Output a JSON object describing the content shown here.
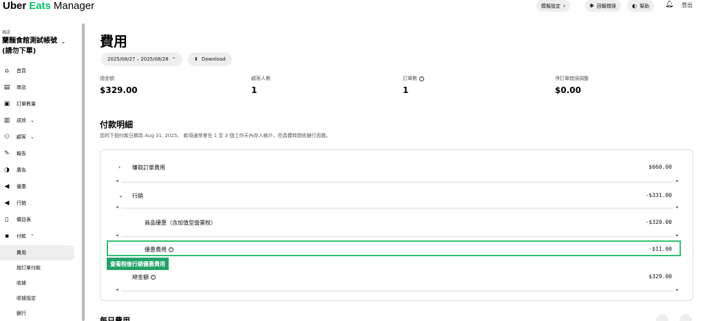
{
  "header": {
    "logo": {
      "uber": "Uber",
      "eats": "Eats",
      "manager": "Manager"
    },
    "buttons": [
      {
        "label": "模擬設定",
        "icon": "chevron-right-icon"
      },
      {
        "label": "回報錯誤",
        "icon": "bug-icon"
      },
      {
        "label": "幫助",
        "icon": "headset-icon"
      }
    ],
    "logout": "登出"
  },
  "sidebar": {
    "store_label": "商店",
    "store_name": "蘭麵食館測試帳號(請勿下單)",
    "items": [
      {
        "label": "首頁",
        "icon": "home-icon"
      },
      {
        "label": "商店",
        "icon": "store-icon"
      },
      {
        "label": "訂單數量",
        "icon": "receipt-icon"
      },
      {
        "label": "成效",
        "icon": "bar-chart-icon"
      },
      {
        "label": "顧客",
        "icon": "people-icon"
      },
      {
        "label": "報告",
        "icon": "report-icon"
      },
      {
        "label": "廣告",
        "icon": "ads-icon"
      },
      {
        "label": "優惠",
        "icon": "megaphone-icon"
      },
      {
        "label": "行銷",
        "icon": "megaphone-icon"
      },
      {
        "label": "價目表",
        "icon": "book-icon"
      },
      {
        "label": "付款",
        "icon": "wallet-icon"
      }
    ],
    "sub_items": [
      "費用",
      "按訂單付款",
      "收據",
      "收據設定",
      "銀行"
    ]
  },
  "main": {
    "title": "費用",
    "date_range": "2025/08/27 – 2025/08/28",
    "download_label": "Download",
    "stats": [
      {
        "label": "總金額",
        "value": "$329.00"
      },
      {
        "label": "顧客人數",
        "value": "1"
      },
      {
        "label": "訂單數",
        "value": "1"
      },
      {
        "label": "淨訂單錯誤調整",
        "value": "$0.00"
      }
    ],
    "payment_title": "付款明細",
    "payment_desc": "您的下個付款日期為 Aug 31, 2025。 款項通常會在 1 至 3 個工作天內存入帳戶，但具體時間依銀行而異。",
    "rows": [
      {
        "label": "賺取訂單費用",
        "amount": "$660.00"
      },
      {
        "label": "行銷",
        "amount": "-$331.00"
      },
      {
        "label": "商品優惠（含加值型營業稅）",
        "amount": "-$320.00"
      },
      {
        "label": "優惠費用",
        "amount": "-$11.00"
      },
      {
        "label": "總金額",
        "amount": "$329.00"
      }
    ],
    "highlight_tag": "查看稅後行銷優惠費用",
    "daily_title": "每日費用"
  },
  "colors": {
    "accent": "#06c167",
    "highlight": "#21a366"
  }
}
